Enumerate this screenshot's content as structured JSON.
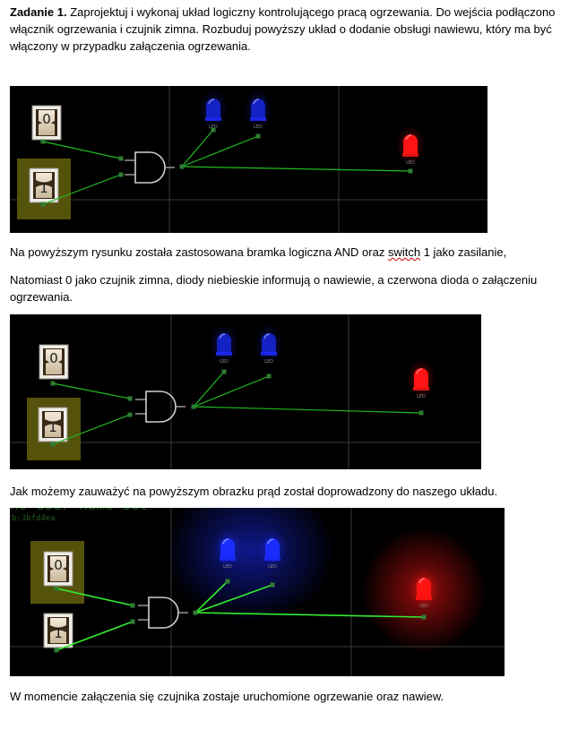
{
  "task": {
    "label": "Zadanie 1.",
    "text": "Zaprojektuj i wykonaj układ logiczny kontrolującego pracą ogrzewania. Do wejścia podłączono włącznik ogrzewania i czujnik zimna. Rozbuduj powyższy układ o dodanie obsługi nawiewu, który ma być włączony w przypadku załączenia ogrzewania."
  },
  "caption1": {
    "before": "Na powyższym rysunku została zastosowana bramka logiczna AND oraz ",
    "flagged": "switch",
    "after": " 1 jako zasilanie,"
  },
  "caption2": "Natomiast 0 jako czujnik zimna, diody niebieskie informują o nawiewie, a czerwona dioda o załączeniu ogrzewania.",
  "caption3": "Jak możemy zauważyć na powyższym obrazku prąd został doprowadzony do naszego układu.",
  "caption4": "W momencie załączenia się czujnika zostaje uruchomione ogrzewanie oraz nawiew.",
  "circuit": {
    "switch_top_label": "0",
    "switch_bottom_label": "1",
    "led_label": "LED",
    "blue_color": "#1b2cff",
    "red_color": "#ff1414",
    "wire_color": "#22bb22",
    "gate": "AND",
    "shot3_overlay_title": "no user name set",
    "shot3_overlay_subtitle": "b:3bfd4ea"
  },
  "icons": [
    "toggle-switch-icon",
    "and-gate-icon",
    "led-icon"
  ]
}
